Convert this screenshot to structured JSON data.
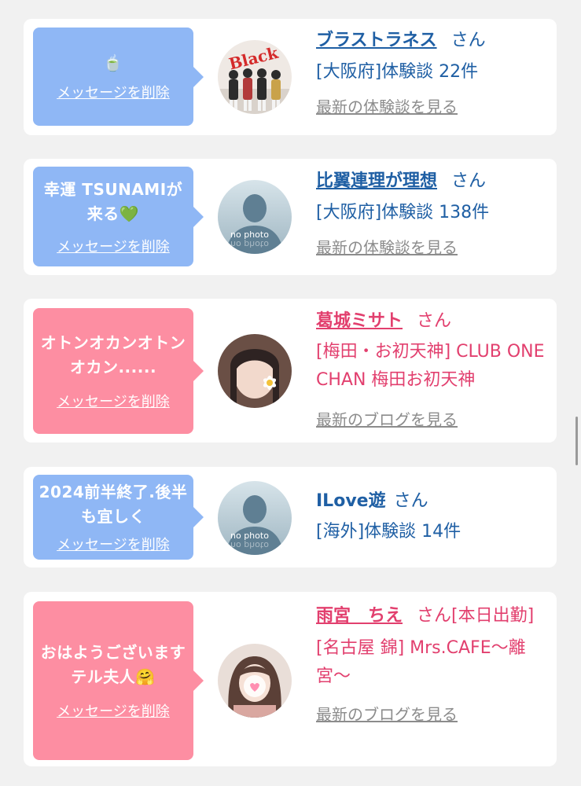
{
  "cards": [
    {
      "theme": "blue",
      "message": "🍵",
      "delete_label": "メッセージを削除",
      "name": "ブラストラネス",
      "honorific": "さん",
      "detail": "[大阪府]体験談 22件",
      "link": "最新の体験談を見る",
      "avatar_text": "Black"
    },
    {
      "theme": "blue",
      "message": "幸運 TSUNAMIが来る💚",
      "delete_label": "メッセージを削除",
      "name": "比翼連理が理想",
      "honorific": "さん",
      "detail": "[大阪府]体験談 138件",
      "link": "最新の体験談を見る",
      "avatar_text": "no photo"
    },
    {
      "theme": "pink",
      "message": "オトンオカンオトンオカン......",
      "delete_label": "メッセージを削除",
      "name": "葛城ミサト",
      "honorific": "さん",
      "detail": "[梅田・お初天神] CLUB ONE CHAN 梅田お初天神",
      "link": "最新のブログを見る"
    },
    {
      "theme": "blue",
      "message": "2024前半終了.後半も宜しく",
      "delete_label": "メッセージを削除",
      "name": "ILove遊",
      "honorific": "さん",
      "detail": "[海外]体験談 14件",
      "avatar_text": "no photo"
    },
    {
      "theme": "pink",
      "message": "おはようございますテル夫人🤗",
      "delete_label": "メッセージを削除",
      "name": "雨宮　ちえ",
      "honorific": "さん[本日出勤]",
      "detail": "[名古屋 錦] Mrs.CAFE〜離宮〜",
      "link": "最新のブログを見る"
    }
  ],
  "colors": {
    "background": "#f1f1f1",
    "card": "#ffffff",
    "bubble_blue": "#8fb7f5",
    "bubble_pink": "#fd8ea2",
    "name_blue": "#1f5fa4",
    "name_pink": "#e23f6e",
    "link_gray": "#8c8c8c"
  }
}
